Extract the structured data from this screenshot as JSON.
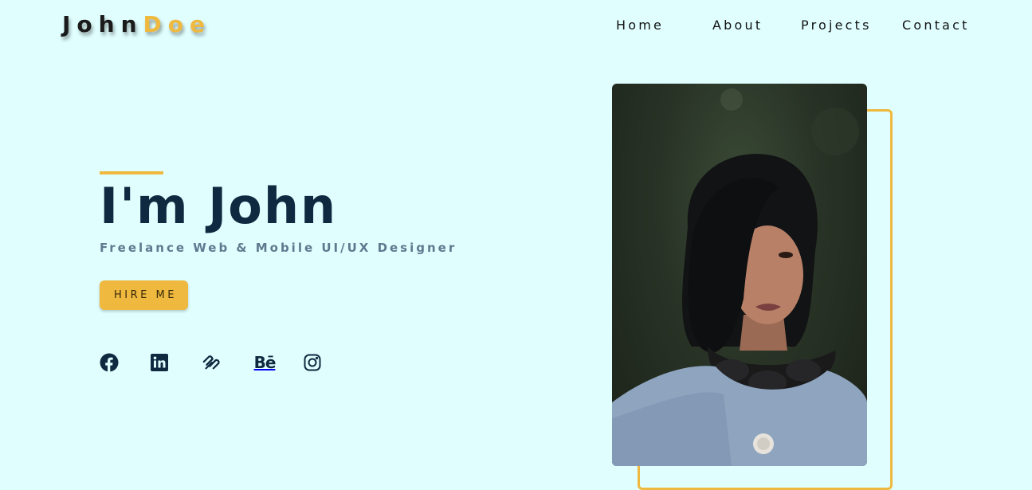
{
  "header": {
    "logo_first": "John",
    "logo_last": "Doe",
    "nav": [
      {
        "label": "Home"
      },
      {
        "label": "About"
      },
      {
        "label": "Projects"
      },
      {
        "label": "Contact"
      }
    ]
  },
  "hero": {
    "title": "I'm John",
    "subtitle": "Freelance Web & Mobile UI/UX Designer",
    "cta_label": "HIRE ME",
    "behance_text": "Bē",
    "socials": [
      {
        "icon": "facebook-icon"
      },
      {
        "icon": "linkedin-icon"
      },
      {
        "icon": "squarespace-icon"
      },
      {
        "icon": "behance-icon"
      },
      {
        "icon": "instagram-icon"
      }
    ]
  },
  "colors": {
    "background": "#e0fefe",
    "accent": "#efb93f",
    "heading": "#0f2940",
    "subtitle": "#60798f"
  }
}
